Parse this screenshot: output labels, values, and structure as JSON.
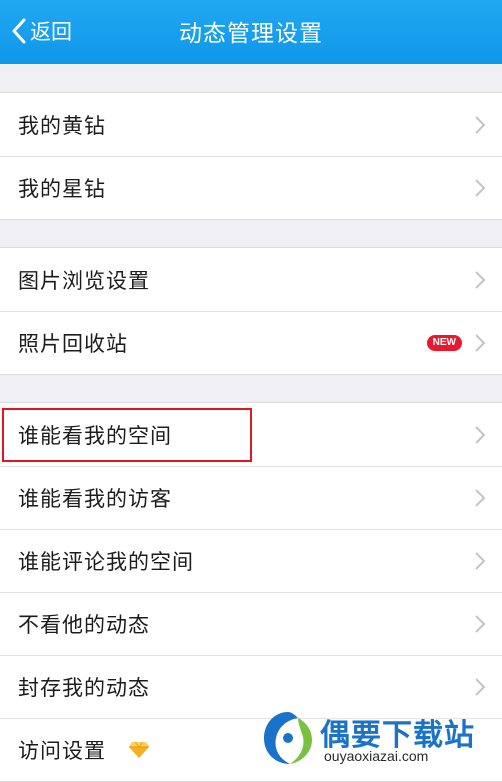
{
  "nav": {
    "back_label": "返回",
    "title": "动态管理设置"
  },
  "groups": [
    {
      "items": [
        {
          "label": "我的黄钻"
        },
        {
          "label": "我的星钻"
        }
      ]
    },
    {
      "items": [
        {
          "label": "图片浏览设置"
        },
        {
          "label": "照片回收站",
          "badge": "NEW"
        }
      ]
    },
    {
      "items": [
        {
          "label": "谁能看我的空间"
        },
        {
          "label": "谁能看我的访客"
        },
        {
          "label": "谁能评论我的空间"
        },
        {
          "label": "不看他的动态"
        },
        {
          "label": "封存我的动态"
        },
        {
          "label": "访问设置"
        }
      ]
    }
  ],
  "watermark": {
    "text": "偶要下载站",
    "url": "ouyaoxiazai.com"
  },
  "colors": {
    "navbar": "#12A0EE",
    "highlight": "#E3161E",
    "badge": "#E8192C",
    "diamond": "#F5B021"
  }
}
